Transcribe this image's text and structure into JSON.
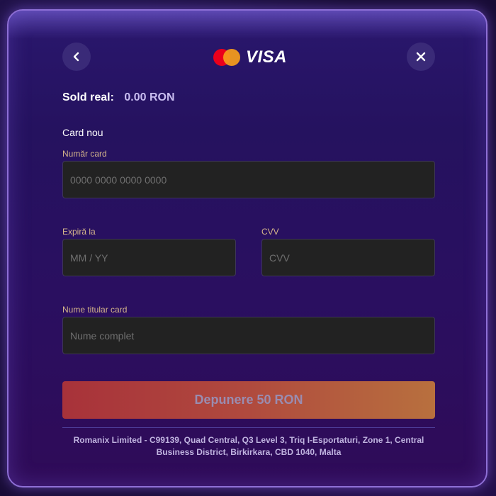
{
  "header": {
    "back_icon": "chevron-left-icon",
    "close_icon": "close-icon",
    "brand_logos": [
      "mastercard",
      "visa"
    ],
    "visa_text": "VISA"
  },
  "balance": {
    "label": "Sold real:",
    "value": "0.00 RON"
  },
  "form": {
    "section_title": "Card nou",
    "card_number": {
      "label": "Număr card",
      "placeholder": "0000 0000 0000 0000"
    },
    "expiry": {
      "label": "Expiră la",
      "placeholder": "MM / YY"
    },
    "cvv": {
      "label": "CVV",
      "placeholder": "CVV"
    },
    "holder": {
      "label": "Nume titular card",
      "placeholder": "Nume complet"
    },
    "submit_label": "Depunere 50 RON"
  },
  "footer": {
    "text": "Romanix Limited - C99139, Quad Central, Q3 Level 3, Triq I-Esportaturi, Zone 1, Central Business District, Birkirkara, CBD 1040, Malta"
  },
  "colors": {
    "accent_label": "#d4b58a",
    "modal_border": "#8e6fd6",
    "button_start": "#a8323a",
    "button_end": "#b8703e"
  }
}
